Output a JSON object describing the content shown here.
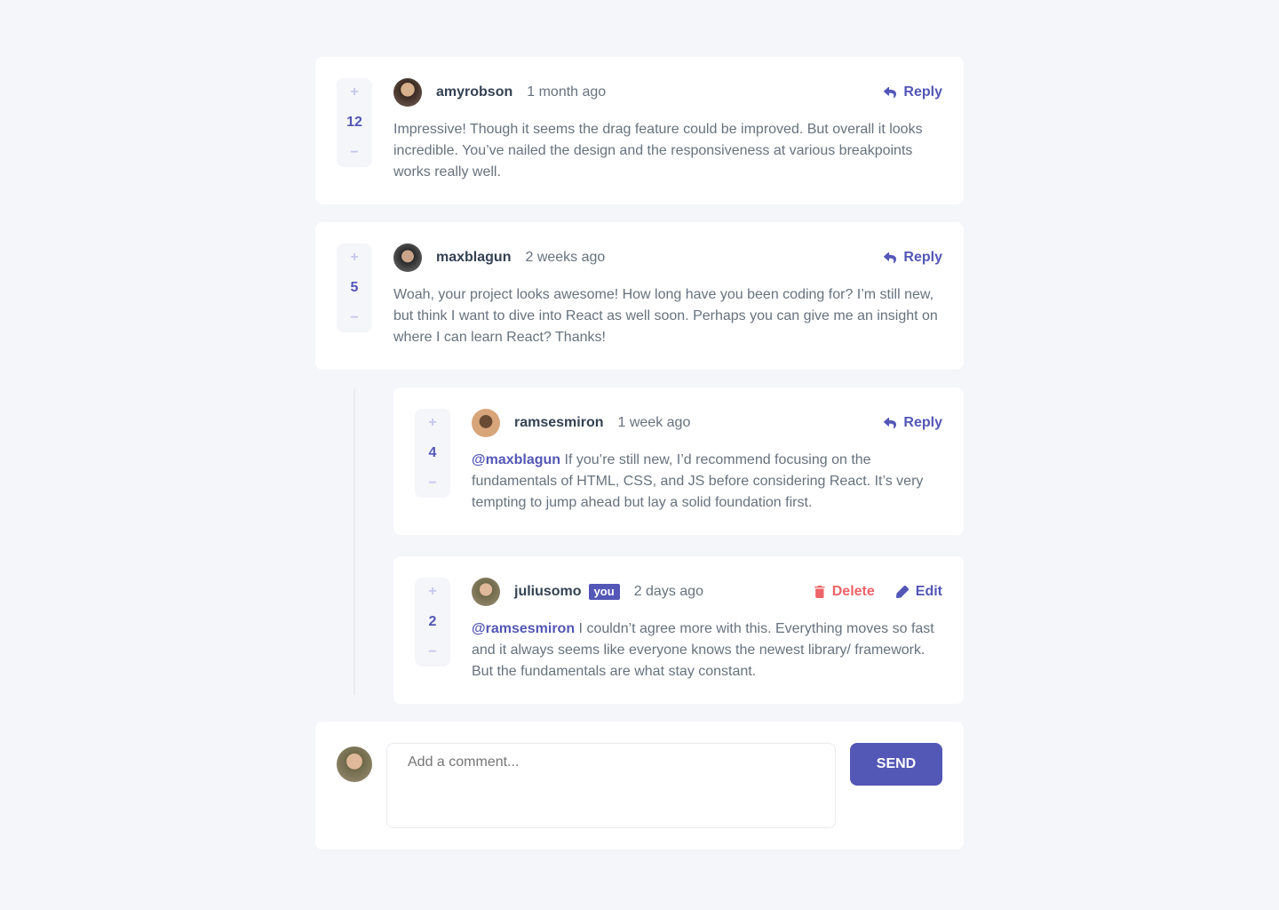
{
  "colors": {
    "primary": "#5357b6",
    "danger": "#ed6368",
    "text": "#67727e",
    "heading": "#334253",
    "bg": "#f5f6fa"
  },
  "comments": [
    {
      "user": "amyrobson",
      "time": "1 month ago",
      "score": "12",
      "reply": "Reply",
      "mention": "",
      "text": "Impressive! Though it seems the drag feature could be improved. But overall it looks incredible. You’ve nailed the design and the responsiveness at various breakpoints works really well.",
      "avatar": "#6b4b3e"
    },
    {
      "user": "maxblagun",
      "time": "2 weeks ago",
      "score": "5",
      "reply": "Reply",
      "mention": "",
      "text": "Woah, your project looks awesome! How long have you been coding for? I’m still new, but think I want to dive into React as well soon. Perhaps you can give me an insight on where I can learn React? Thanks!",
      "avatar": "#3a3a3a"
    }
  ],
  "replies": [
    {
      "user": "ramsesmiron",
      "time": "1 week ago",
      "score": "4",
      "reply": "Reply",
      "mention": "@maxblagun",
      "text": "If you’re still new, I’d recommend focusing on the fundamentals of HTML, CSS, and JS before considering React. It’s very tempting to jump ahead but lay a solid foundation first.",
      "avatar": "#c98a5a"
    },
    {
      "user": "juliusomo",
      "you": "you",
      "time": "2 days ago",
      "score": "2",
      "delete": "Delete",
      "edit": "Edit",
      "mention": "@ramsesmiron",
      "text": "I couldn’t agree more with this. Everything moves so fast and it always seems like everyone knows the newest library/ framework. But the fundamentals are what stay constant.",
      "avatar": "#6e6a4a"
    }
  ],
  "vote": {
    "plus": "+",
    "minus": "−"
  },
  "composer": {
    "placeholder": "Add a comment...",
    "send": "SEND"
  }
}
